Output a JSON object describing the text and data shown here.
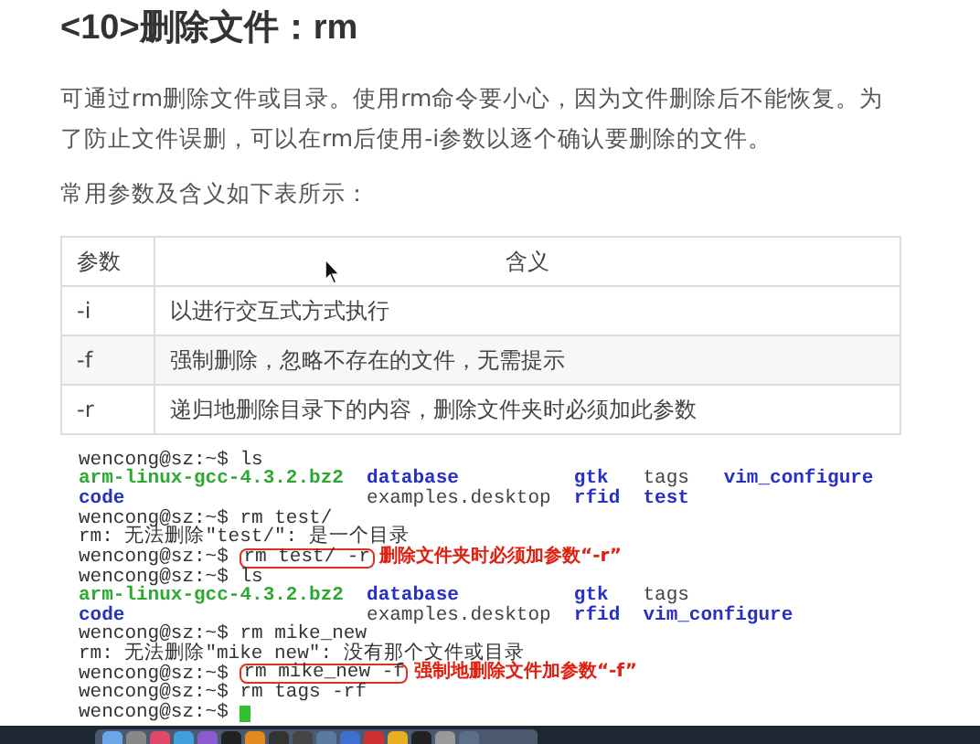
{
  "heading": "<10>删除文件：rm",
  "paragraphs": [
    "可通过rm删除文件或目录。使用rm命令要小心，因为文件删除后不能恢复。为了防止文件误删，可以在rm后使用-i参数以逐个确认要删除的文件。",
    "常用参数及含义如下表所示："
  ],
  "table": {
    "columns": [
      "参数",
      "含义"
    ],
    "rows": [
      [
        "-i",
        "以进行交互式方式执行"
      ],
      [
        "-f",
        "强制删除，忽略不存在的文件，无需提示"
      ],
      [
        "-r",
        "递归地删除目录下的内容，删除文件夹时必须加此参数"
      ]
    ]
  },
  "terminal": [
    {
      "kind": "command",
      "prompt": "wencong@sz:~$",
      "command": "ls"
    },
    {
      "kind": "listing",
      "cells": [
        {
          "text": "arm-linux-gcc-4.3.2.bz2",
          "kind": "archive"
        },
        {
          "text": "database",
          "kind": "dir"
        },
        {
          "text": "gtk",
          "kind": "dir"
        },
        {
          "text": "tags",
          "kind": "file"
        },
        {
          "text": "vim_configure",
          "kind": "dir"
        }
      ]
    },
    {
      "kind": "listing",
      "cells": [
        {
          "text": "code",
          "kind": "dir"
        },
        {
          "text": "examples.desktop",
          "kind": "file"
        },
        {
          "text": "rfid",
          "kind": "dir"
        },
        {
          "text": "test",
          "kind": "dir"
        }
      ]
    },
    {
      "kind": "command",
      "prompt": "wencong@sz:~$",
      "command": "rm test/"
    },
    {
      "kind": "output",
      "text": "rm: 无法删除\"test/\": 是一个目录"
    },
    {
      "kind": "command",
      "prompt": "wencong@sz:~$",
      "command": "rm test/ -r",
      "boxed": true,
      "note": "删除文件夹时必须加参数“-r”"
    },
    {
      "kind": "command",
      "prompt": "wencong@sz:~$",
      "command": "ls"
    },
    {
      "kind": "listing",
      "cells": [
        {
          "text": "arm-linux-gcc-4.3.2.bz2",
          "kind": "archive"
        },
        {
          "text": "database",
          "kind": "dir"
        },
        {
          "text": "gtk",
          "kind": "dir"
        },
        {
          "text": "tags",
          "kind": "file"
        }
      ]
    },
    {
      "kind": "listing",
      "cells": [
        {
          "text": "code",
          "kind": "dir"
        },
        {
          "text": "examples.desktop",
          "kind": "file"
        },
        {
          "text": "rfid",
          "kind": "dir"
        },
        {
          "text": "vim_configure",
          "kind": "dir"
        }
      ]
    },
    {
      "kind": "command",
      "prompt": "wencong@sz:~$",
      "command": "rm mike_new"
    },
    {
      "kind": "output",
      "text": "rm: 无法删除\"mike new\": 没有那个文件或目录"
    },
    {
      "kind": "command",
      "prompt": "wencong@sz:~$",
      "command": "rm mike_new -f",
      "boxed": true,
      "note": "强制地删除文件加参数“-f”"
    },
    {
      "kind": "command",
      "prompt": "wencong@sz:~$",
      "command": "rm tags -rf"
    },
    {
      "kind": "command",
      "prompt": "wencong@sz:~$",
      "cursor": true
    }
  ]
}
